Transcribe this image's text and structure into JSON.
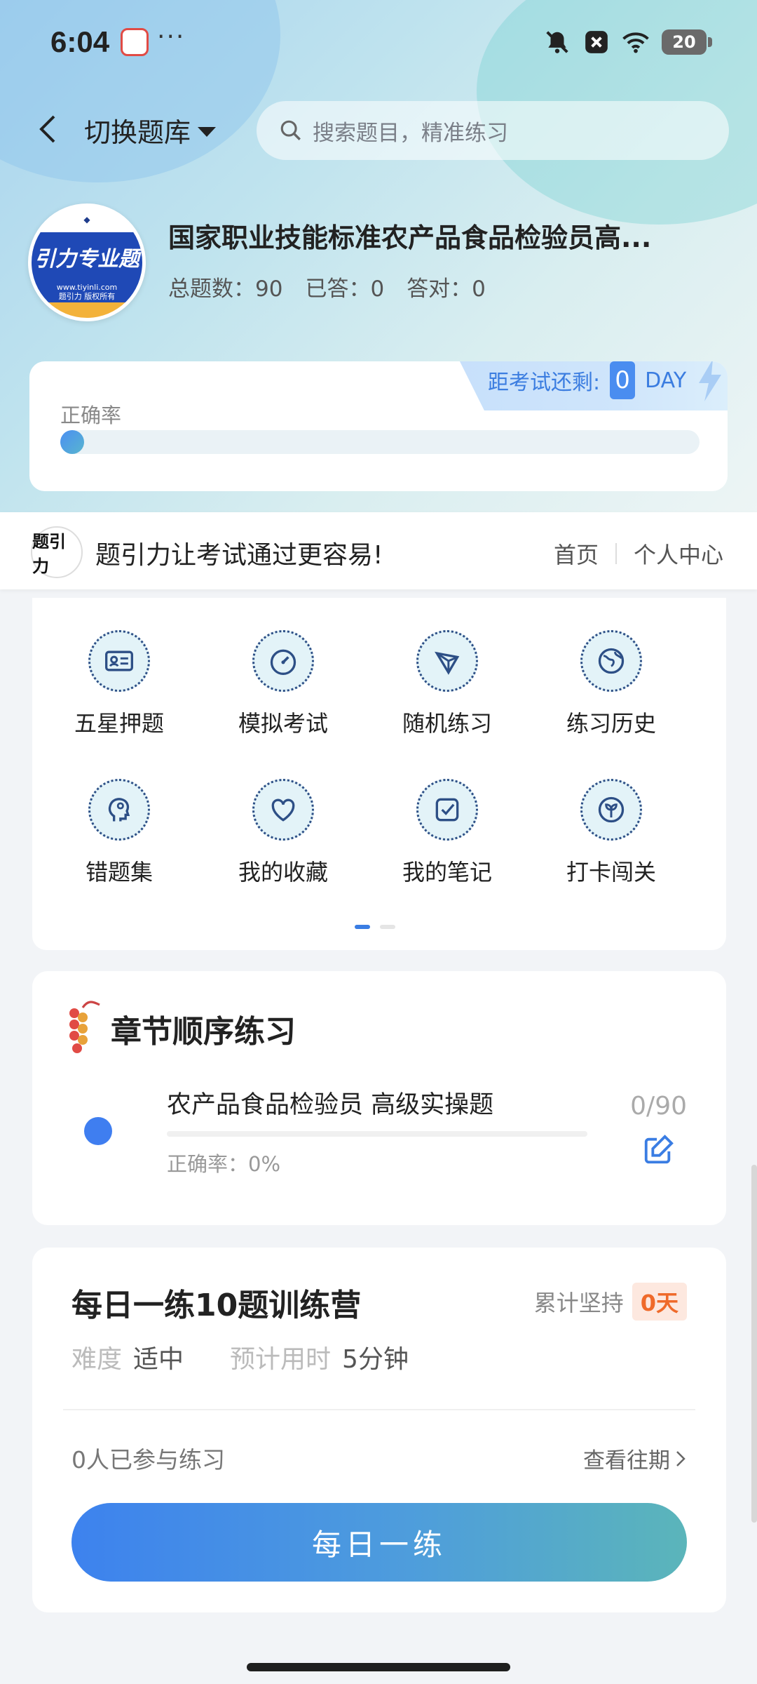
{
  "status_bar": {
    "time": "6:04",
    "more": "···",
    "battery": "20"
  },
  "topbar": {
    "switch_label": "切换题库",
    "search_placeholder": "搜索题目，精准练习"
  },
  "course": {
    "logo_text": "引力专业题",
    "logo_url": "www.tiyinli.com",
    "logo_copyright": "题引力 版权所有",
    "title": "国家职业技能标准农产品食品检验员高...",
    "total": "总题数：90",
    "answered": "已答：0",
    "correct": "答对：0"
  },
  "accuracy": {
    "label": "正确率",
    "countdown_label": "距考试还剩:",
    "countdown_days": "0",
    "countdown_unit": "DAY",
    "progress": 0
  },
  "brand": {
    "logo_text": "题引力",
    "slogan": "题引力让考试通过更容易!",
    "home": "首页",
    "personal": "个人中心"
  },
  "features": [
    {
      "label": "五星押题",
      "icon": "id-card-icon"
    },
    {
      "label": "模拟考试",
      "icon": "speedometer-icon"
    },
    {
      "label": "随机练习",
      "icon": "network-icon"
    },
    {
      "label": "练习历史",
      "icon": "globe-icon"
    },
    {
      "label": "错题集",
      "icon": "head-icon"
    },
    {
      "label": "我的收藏",
      "icon": "heart-icon"
    },
    {
      "label": "我的笔记",
      "icon": "note-check-icon"
    },
    {
      "label": "打卡闯关",
      "icon": "sprout-icon"
    }
  ],
  "chapter": {
    "title": "章节顺序练习",
    "name": "农产品食品检验员 高级实操题",
    "accuracy": "正确率：0%",
    "count": "0/90"
  },
  "daily": {
    "title": "每日一练10题训练营",
    "streak_label": "累计坚持",
    "streak_value": "0天",
    "difficulty_key": "难度",
    "difficulty_val": "适中",
    "time_key": "预计用时",
    "time_val": "5分钟",
    "participants": "0人已参与练习",
    "history": "查看往期",
    "button": "每日一练"
  },
  "colors": {
    "accent": "#3d82ee",
    "streak": "#ef6a2a"
  }
}
